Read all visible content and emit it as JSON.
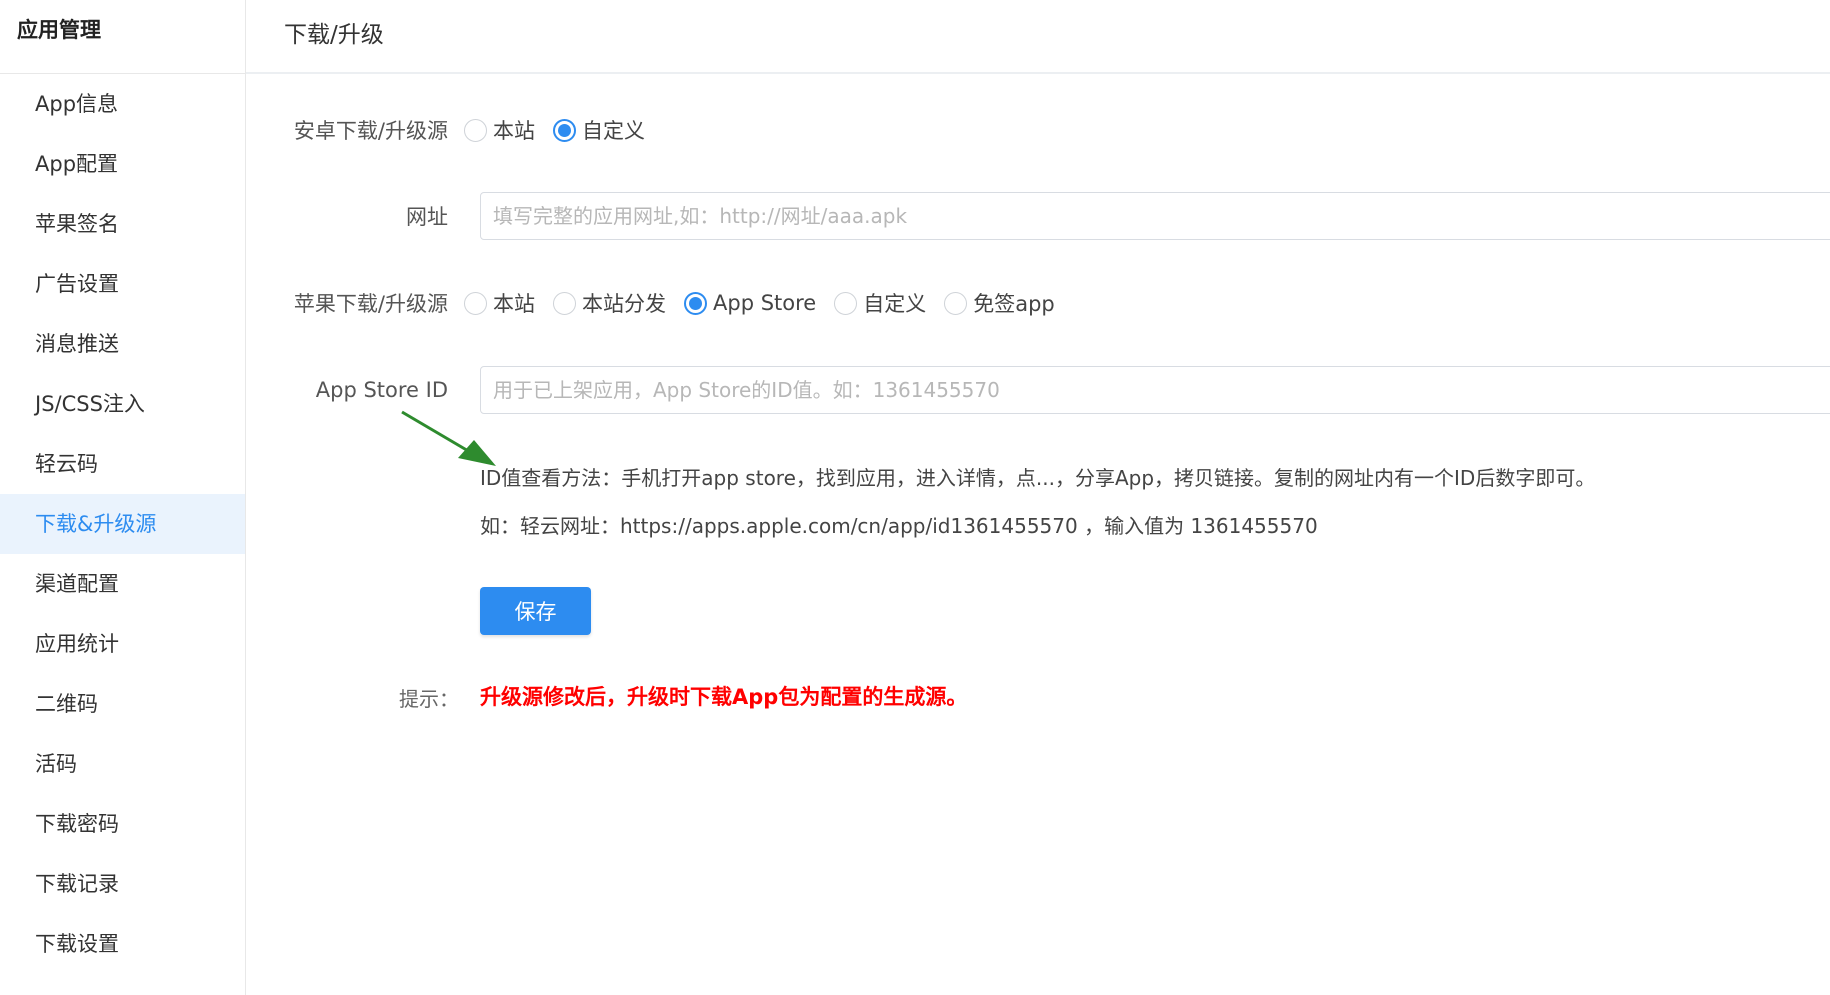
{
  "sidebar": {
    "title": "应用管理",
    "items": [
      {
        "label": "App信息",
        "active": false
      },
      {
        "label": "App配置",
        "active": false
      },
      {
        "label": "苹果签名",
        "active": false
      },
      {
        "label": "广告设置",
        "active": false
      },
      {
        "label": "消息推送",
        "active": false
      },
      {
        "label": "JS/CSS注入",
        "active": false
      },
      {
        "label": "轻云码",
        "active": false
      },
      {
        "label": "下载&升级源",
        "active": true
      },
      {
        "label": "渠道配置",
        "active": false
      },
      {
        "label": "应用统计",
        "active": false
      },
      {
        "label": "二维码",
        "active": false
      },
      {
        "label": "活码",
        "active": false
      },
      {
        "label": "下载密码",
        "active": false
      },
      {
        "label": "下载记录",
        "active": false
      },
      {
        "label": "下载设置",
        "active": false
      }
    ]
  },
  "header": {
    "title": "下载/升级"
  },
  "form": {
    "android_source": {
      "label": "安卓下载/升级源",
      "options": [
        {
          "label": "本站",
          "checked": false
        },
        {
          "label": "自定义",
          "checked": true
        }
      ]
    },
    "url": {
      "label": "网址",
      "value": "",
      "placeholder": "填写完整的应用网址,如：http://网址/aaa.apk"
    },
    "apple_source": {
      "label": "苹果下载/升级源",
      "options": [
        {
          "label": "本站",
          "checked": false
        },
        {
          "label": "本站分发",
          "checked": false
        },
        {
          "label": "App Store",
          "checked": true
        },
        {
          "label": "自定义",
          "checked": false
        },
        {
          "label": "免签app",
          "checked": false
        }
      ]
    },
    "appstore_id": {
      "label": "App Store ID",
      "value": "",
      "placeholder": "用于已上架应用，App Store的ID值。如：1361455570"
    },
    "help_line1": "ID值查看方法：手机打开app store，找到应用，进入详情，点...，分享App，拷贝链接。复制的网址内有一个ID后数字即可。",
    "help_line2": "如：轻云网址：https://apps.apple.com/cn/app/id1361455570 ，输入值为 1361455570",
    "save_label": "保存",
    "tip_label": "提示：",
    "tip_text": "升级源修改后，升级时下载App包为配置的生成源。"
  },
  "colors": {
    "primary": "#2d8cf0",
    "active_bg": "#eaf3fd",
    "warning": "#ff0000",
    "arrow": "#2e8b2e"
  },
  "icons": {
    "annotation_arrow": "green-arrow-icon"
  }
}
